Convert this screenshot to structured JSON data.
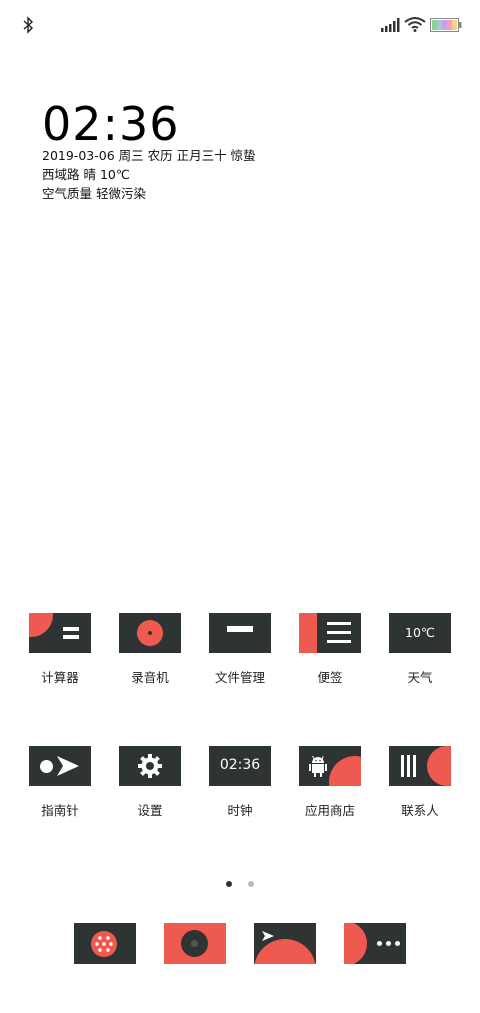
{
  "status_bar": {
    "bluetooth_icon": "bluetooth-icon",
    "signal_icon": "signal-icon",
    "wifi_icon": "wifi-icon",
    "battery_icon": "battery-icon"
  },
  "clock": {
    "time": "02:36",
    "date_line": "2019-03-06 周三 农历 正月三十 惊蛰",
    "location_line": "西域路 晴 10℃",
    "air_line": "空气质量 轻微污染"
  },
  "apps_row1": [
    {
      "label": "计算器",
      "icon": "calculator-icon"
    },
    {
      "label": "录音机",
      "icon": "recorder-icon"
    },
    {
      "label": "文件管理",
      "icon": "file-manager-icon"
    },
    {
      "label": "便签",
      "icon": "notes-icon"
    },
    {
      "label": "天气",
      "icon": "weather-icon",
      "icon_text": "10℃"
    }
  ],
  "apps_row2": [
    {
      "label": "指南针",
      "icon": "compass-icon"
    },
    {
      "label": "设置",
      "icon": "settings-gear-icon"
    },
    {
      "label": "时钟",
      "icon": "clock-icon",
      "icon_text": "02:36"
    },
    {
      "label": "应用商店",
      "icon": "app-store-icon"
    },
    {
      "label": "联系人",
      "icon": "contacts-icon"
    }
  ],
  "page_indicator": {
    "count": 2,
    "active": 1
  },
  "dock": [
    {
      "icon": "phone-dialer-icon"
    },
    {
      "icon": "music-icon"
    },
    {
      "icon": "browser-icon"
    },
    {
      "icon": "messages-icon"
    }
  ],
  "colors": {
    "tile": "#2d3433",
    "accent": "#ef5a50"
  }
}
